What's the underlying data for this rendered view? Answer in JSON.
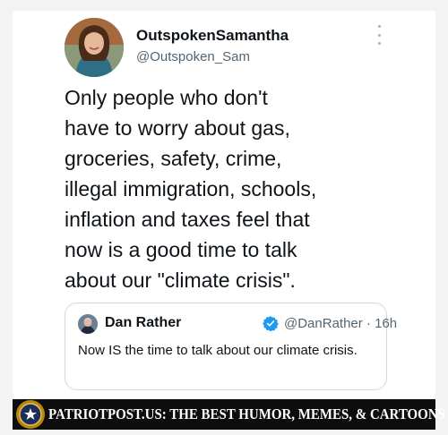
{
  "tweet": {
    "display_name": "OutspokenSamantha",
    "handle": "@Outspoken_Sam",
    "text_lines": [
      "Only people who don't",
      "have to worry about gas,",
      "groceries, safety, crime,",
      "illegal immigration, schools,",
      "inflation and taxes feel that",
      "now is a good time to talk",
      "about our \"climate crisis\"."
    ]
  },
  "quoted_tweet": {
    "display_name": "Dan Rather",
    "handle_time": "@DanRather · 16h",
    "text": "Now IS the time to talk about our climate crisis."
  },
  "banner": {
    "text": "PATRIOTPOST.US: THE BEST HUMOR, MEMES, & CARTOONS"
  },
  "colors": {
    "text_primary": "#0f1419",
    "text_secondary": "#536471",
    "verified_blue": "#1d9bf0",
    "banner_bg": "#0d0d0d"
  },
  "icons": [
    "avatar",
    "more-icon",
    "verified-icon",
    "patriotpost-logo-icon"
  ]
}
